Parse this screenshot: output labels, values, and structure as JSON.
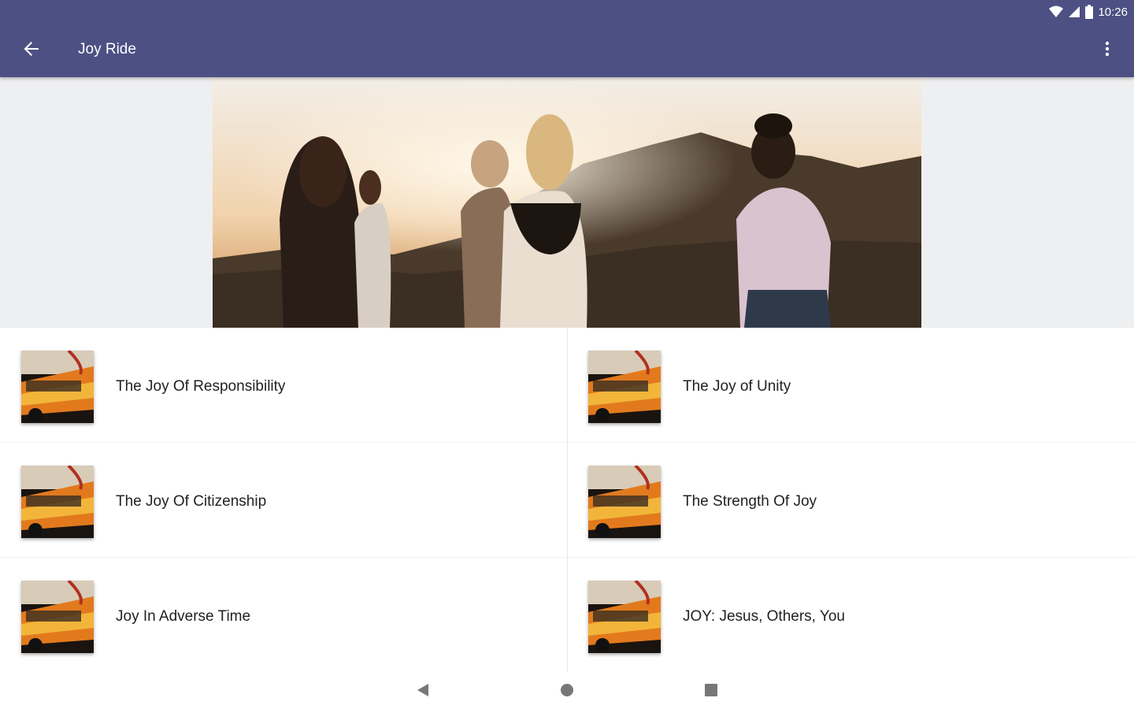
{
  "status": {
    "time": "10:26"
  },
  "appbar": {
    "title": "Joy Ride",
    "back_icon": "arrow-back-icon",
    "overflow_icon": "more-vert-icon"
  },
  "colors": {
    "appbar": "#4c5083",
    "hero_band": "#eeeff0",
    "text": "#222222"
  },
  "items": [
    {
      "title": "The Joy Of Responsibility"
    },
    {
      "title": "The Joy of Unity"
    },
    {
      "title": "The Joy Of Citizenship"
    },
    {
      "title": "The Strength Of Joy"
    },
    {
      "title": "Joy In Adverse Time"
    },
    {
      "title": "JOY: Jesus, Others, You"
    }
  ],
  "navbar": {
    "back_icon": "nav-back-icon",
    "home_icon": "nav-home-icon",
    "recents_icon": "nav-recents-icon"
  }
}
